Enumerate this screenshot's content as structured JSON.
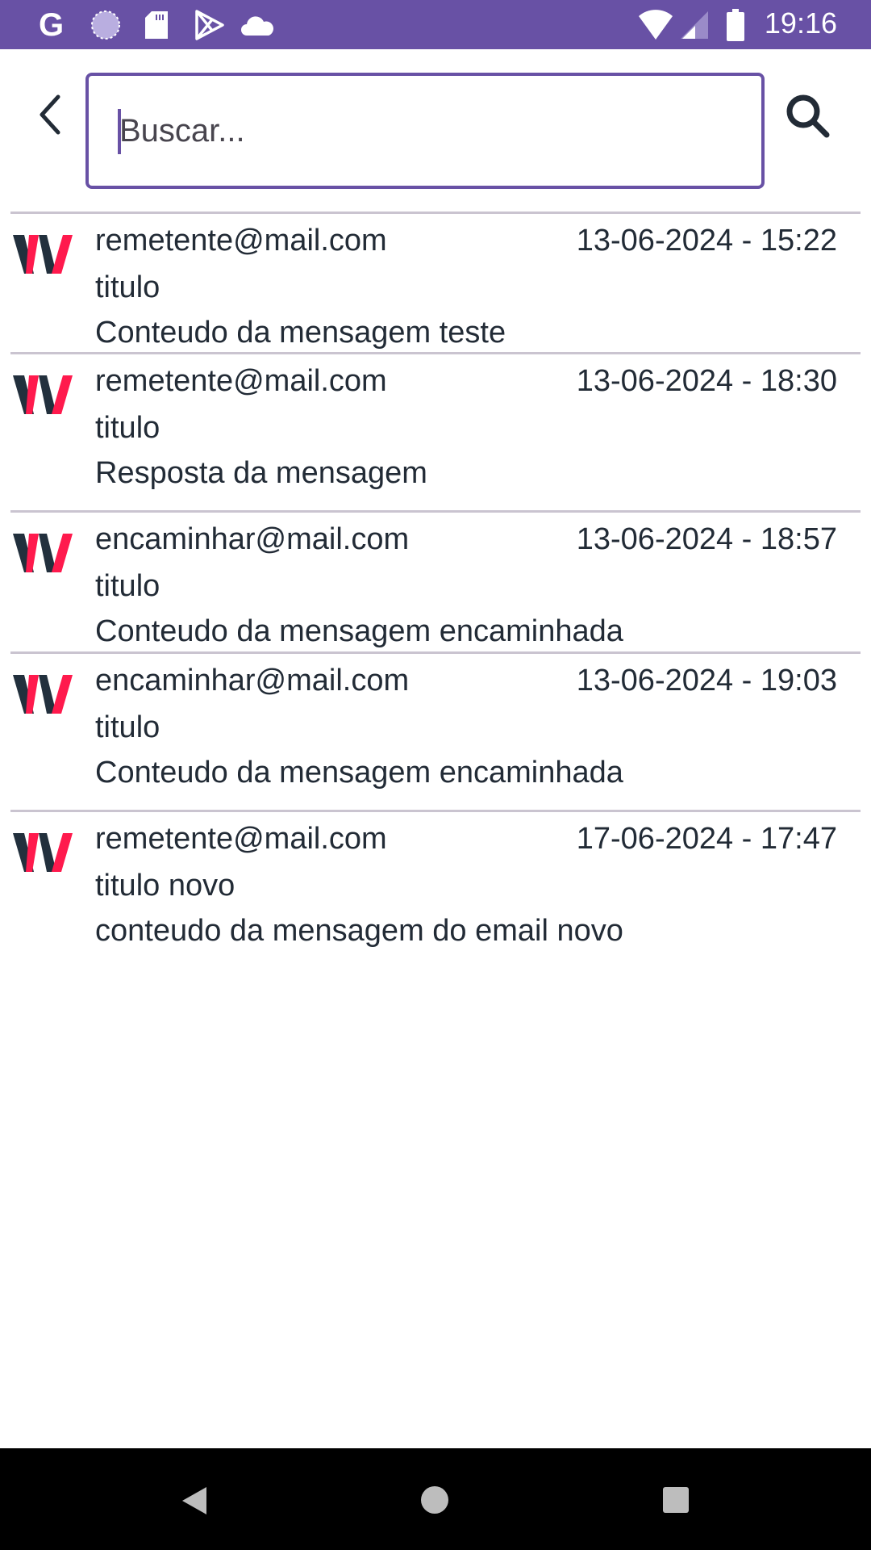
{
  "status_bar": {
    "time": "19:16",
    "icons": [
      "google-icon",
      "sync-icon",
      "sd-card-icon",
      "play-store-icon",
      "cloud-icon",
      "wifi-icon",
      "signal-icon",
      "battery-icon"
    ],
    "color": "#6851a5"
  },
  "search": {
    "placeholder": "Buscar...",
    "value": ""
  },
  "messages": [
    {
      "from": "remetente@mail.com",
      "date": "13-06-2024 - 15:22",
      "title": "titulo",
      "body": "Conteudo da mensagem teste"
    },
    {
      "from": "remetente@mail.com",
      "date": "13-06-2024 - 18:30",
      "title": "titulo",
      "body": "Resposta da mensagem"
    },
    {
      "from": "encaminhar@mail.com",
      "date": "13-06-2024 - 18:57",
      "title": "titulo",
      "body": "Conteudo da mensagem encaminhada"
    },
    {
      "from": "encaminhar@mail.com",
      "date": "13-06-2024 - 19:03",
      "title": "titulo",
      "body": "Conteudo da mensagem encaminhada"
    },
    {
      "from": "remetente@mail.com",
      "date": "17-06-2024 - 17:47",
      "title": "titulo novo",
      "body": "conteudo da mensagem do email novo"
    }
  ]
}
